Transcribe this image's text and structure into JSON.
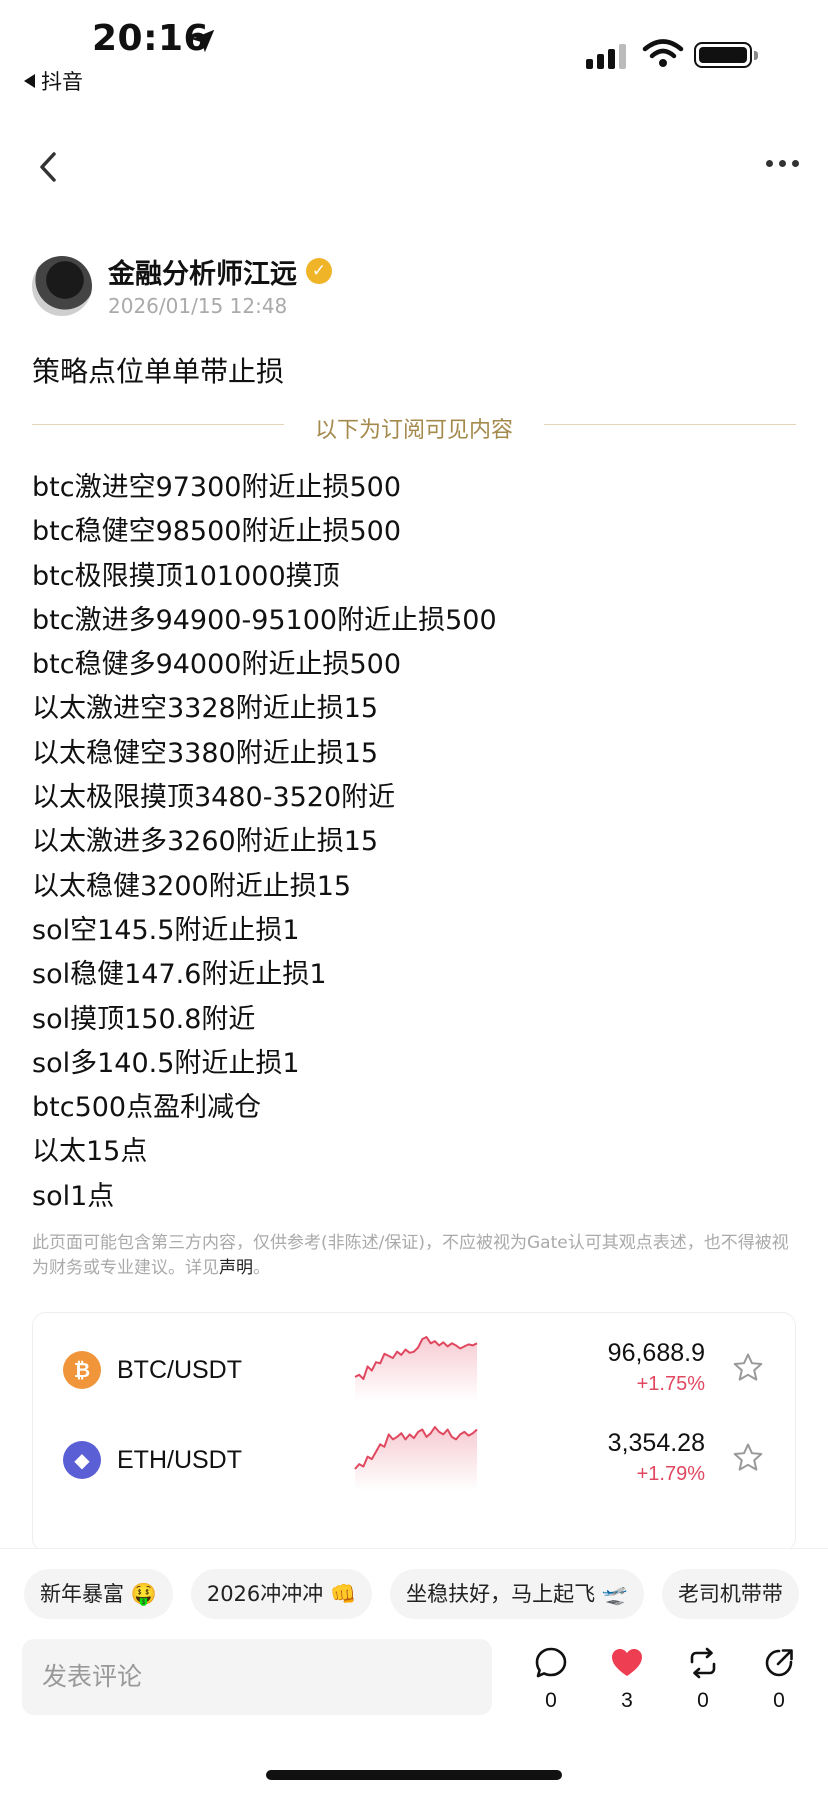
{
  "status_bar": {
    "time": "20:16",
    "back_app": "抖音",
    "icons": [
      "location-arrow-icon",
      "signal-icon",
      "wifi-icon",
      "battery-icon"
    ]
  },
  "nav": {
    "icons": [
      "back-chevron-icon",
      "more-icon"
    ]
  },
  "author": {
    "name": "金融分析师江远",
    "date": "2026/01/15 12:48",
    "verified_badge": "✓"
  },
  "post": {
    "title": "策略点位单单带止损",
    "subscribe_divider": "以下为订阅可见内容",
    "lines": [
      "btc激进空97300附近止损500",
      "btc稳健空98500附近止损500",
      "btc极限摸顶101000摸顶",
      "btc激进多94900-95100附近止损500",
      "btc稳健多94000附近止损500",
      "以太激进空3328附近止损15",
      "以太稳健空3380附近止损15",
      "以太极限摸顶3480-3520附近",
      "以太激进多3260附近止损15",
      "以太稳健3200附近止损15",
      "sol空145.5附近止损1",
      "sol稳健147.6附近止损1",
      "sol摸顶150.8附近",
      "sol多140.5附近止损1",
      "btc500点盈利减仓",
      "以太15点",
      "sol1点"
    ],
    "disclaimer": "此页面可能包含第三方内容，仅供参考(非陈述/保证)，不应被视为Gate认可其观点表述，也不得被视为财务或专业建议。详见",
    "disclaimer_link": "声明",
    "disclaimer_end": "。"
  },
  "markets": [
    {
      "pair": "BTC/USDT",
      "price": "96,688.9",
      "change": "+1.75%",
      "icon": "btc-icon",
      "icon_glyph": "₿",
      "icon_color": "#f0953a",
      "spark": [
        20,
        22,
        18,
        30,
        26,
        34,
        33,
        42,
        40,
        38,
        44,
        41,
        46,
        43,
        44,
        48,
        56,
        58,
        52,
        54,
        50,
        53,
        49,
        52,
        50,
        47,
        49,
        51,
        50,
        52
      ]
    },
    {
      "pair": "ETH/USDT",
      "price": "3,354.28",
      "change": "+1.79%",
      "icon": "eth-icon",
      "icon_glyph": "◆",
      "icon_color": "#5b5fd6",
      "spark": [
        16,
        20,
        18,
        26,
        24,
        30,
        36,
        34,
        44,
        40,
        42,
        45,
        40,
        44,
        41,
        46,
        48,
        42,
        45,
        50,
        46,
        44,
        48,
        42,
        40,
        44,
        46,
        43,
        45,
        48
      ]
    }
  ],
  "accent_up_color": "#e0485f",
  "bottom": {
    "chips": [
      "新年暴富 🤑",
      "2026冲冲冲 👊",
      "坐稳扶好，马上起飞 🛫",
      "老司机带带"
    ],
    "comment_placeholder": "发表评论",
    "actions": [
      {
        "icon": "comment-icon",
        "count": "0"
      },
      {
        "icon": "heart-icon",
        "count": "3"
      },
      {
        "icon": "repost-icon",
        "count": "0"
      },
      {
        "icon": "share-icon",
        "count": "0"
      }
    ]
  }
}
